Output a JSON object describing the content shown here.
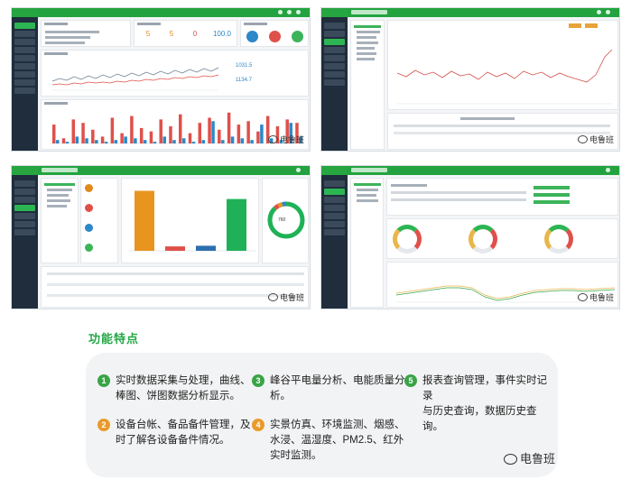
{
  "screens": {
    "dashboard": {
      "kpis": [
        {
          "value": "5",
          "color": "#e08a1e"
        },
        {
          "value": "5",
          "color": "#e08a1e"
        },
        {
          "value": "0",
          "color": "#e0504a"
        },
        {
          "value": "100.0",
          "color": "#2d87c8"
        }
      ],
      "status_colors": [
        "#2d87c8",
        "#e0504a",
        "#3cb45a"
      ],
      "readings": [
        "1031.5",
        "1134.7"
      ],
      "bar_chart_data": {
        "type": "bar",
        "series": [
          {
            "color": "#e0504a",
            "values": [
              0.55,
              0.15,
              0.7,
              0.6,
              0.4,
              0.2,
              0.75,
              0.3,
              0.8,
              0.45,
              0.35,
              0.7,
              0.5,
              0.85,
              0.3,
              0.6,
              0.75,
              0.4,
              0.9,
              0.55,
              0.65,
              0.35,
              0.8,
              0.5,
              0.7,
              0.6
            ]
          },
          {
            "color": "#2d87c8",
            "values": [
              0.1,
              0.05,
              0.2,
              0.15,
              0.1,
              0.05,
              0.1,
              0.2,
              0.15,
              0.1,
              0.05,
              0.2,
              0.1,
              0.15,
              0.05,
              0.1,
              0.65,
              0.1,
              0.2,
              0.15,
              0.1,
              0.55,
              0.15,
              0.1,
              0.6,
              0.2
            ]
          }
        ]
      }
    },
    "equipment": {
      "status_colors": [
        "#e08a1e",
        "#e0504a",
        "#2d87c8",
        "#3cb45a"
      ],
      "bar_chart_data": {
        "type": "bar",
        "values": [
          0.95,
          0.07,
          0.08,
          0.82
        ],
        "colors": [
          "#e8951f",
          "#e0504a",
          "#2d6fae",
          "#1fb157"
        ]
      },
      "ring_chart_data": {
        "type": "pie",
        "center_value": "760",
        "values": [
          0.88,
          0.04,
          0.04,
          0.04
        ],
        "colors": [
          "#1fb157",
          "#e0504a",
          "#e8951f",
          "#2d87c8"
        ]
      }
    }
  },
  "features": {
    "title": "功能特点",
    "items": [
      {
        "num": "1",
        "color": "green",
        "text": "实时数据采集与处理，曲线、\n棒图、饼图数据分析显示。"
      },
      {
        "num": "2",
        "color": "orange",
        "text": "设备台帐、备品备件管理，及\n时了解各设备备件情况。"
      },
      {
        "num": "3",
        "color": "green",
        "text": "峰谷平电量分析、电能质量分\n析。"
      },
      {
        "num": "4",
        "color": "orange",
        "text": "实景仿真、环境监测、烟感、\n水浸、温湿度、PM2.5、红外\n实时监测。"
      },
      {
        "num": "5",
        "color": "green",
        "text": "报表查询管理，事件实时记录\n与历史查询，数据历史查询。"
      }
    ]
  },
  "watermark": "电鲁班"
}
